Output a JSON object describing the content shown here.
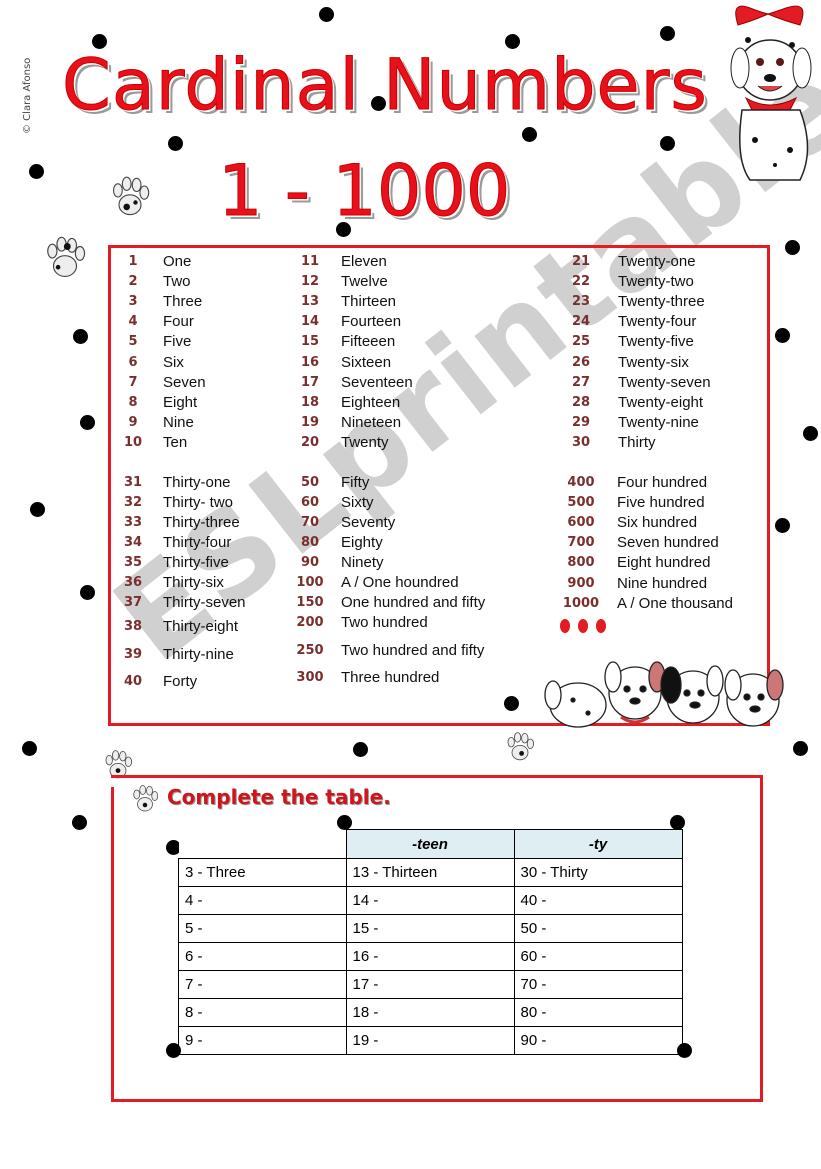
{
  "page": {
    "copyright": "© Clara Afonso",
    "title": "Cardinal Numbers",
    "subtitle": "1 - 1000",
    "watermark": "ESLprintables.com"
  },
  "colors": {
    "title_red": "#e8101a",
    "frame_red": "#e31b23",
    "number_brown": "#7a2e2e",
    "table_header_bg": "#dfeef2"
  },
  "numbers": {
    "col1": [
      {
        "n": "1",
        "w": "One"
      },
      {
        "n": "2",
        "w": "Two"
      },
      {
        "n": "3",
        "w": "Three"
      },
      {
        "n": "4",
        "w": "Four"
      },
      {
        "n": "5",
        "w": "Five"
      },
      {
        "n": "6",
        "w": "Six"
      },
      {
        "n": "7",
        "w": "Seven"
      },
      {
        "n": "8",
        "w": "Eight"
      },
      {
        "n": "9",
        "w": "Nine"
      },
      {
        "n": "10",
        "w": "Ten"
      }
    ],
    "col2": [
      {
        "n": "11",
        "w": "Eleven"
      },
      {
        "n": "12",
        "w": "Twelve"
      },
      {
        "n": "13",
        "w": "Thirteen"
      },
      {
        "n": "14",
        "w": "Fourteen"
      },
      {
        "n": "15",
        "w": "Fifteeen"
      },
      {
        "n": "16",
        "w": "Sixteen"
      },
      {
        "n": "17",
        "w": "Seventeen"
      },
      {
        "n": "18",
        "w": "Eighteen"
      },
      {
        "n": "19",
        "w": "Nineteen"
      },
      {
        "n": "20",
        "w": "Twenty"
      }
    ],
    "col3": [
      {
        "n": "21",
        "w": "Twenty-one"
      },
      {
        "n": "22",
        "w": "Twenty-two"
      },
      {
        "n": "23",
        "w": "Twenty-three"
      },
      {
        "n": "24",
        "w": "Twenty-four"
      },
      {
        "n": "25",
        "w": "Twenty-five"
      },
      {
        "n": "26",
        "w": "Twenty-six"
      },
      {
        "n": "27",
        "w": "Twenty-seven"
      },
      {
        "n": "28",
        "w": "Twenty-eight"
      },
      {
        "n": "29",
        "w": "Twenty-nine"
      },
      {
        "n": "30",
        "w": "Thirty"
      }
    ],
    "col4": [
      {
        "n": "31",
        "w": "Thirty-one"
      },
      {
        "n": "32",
        "w": "Thirty- two"
      },
      {
        "n": "33",
        "w": "Thirty-three"
      },
      {
        "n": "34",
        "w": "Thirty-four"
      },
      {
        "n": "35",
        "w": "Thirty-five"
      },
      {
        "n": "36",
        "w": "Thirty-six"
      },
      {
        "n": "37",
        "w": "Thirty-seven"
      },
      {
        "n": "38",
        "w": "Thirty-eight"
      },
      {
        "n": "39",
        "w": "Thirty-nine"
      },
      {
        "n": "40",
        "w": "Forty"
      }
    ],
    "col5": [
      {
        "n": "50",
        "w": "Fifty"
      },
      {
        "n": "60",
        "w": "Sixty"
      },
      {
        "n": "70",
        "w": "Seventy"
      },
      {
        "n": "80",
        "w": "Eighty"
      },
      {
        "n": "90",
        "w": "Ninety"
      },
      {
        "n": "100",
        "w": "A / One houndred"
      },
      {
        "n": "150",
        "w": "One hundred and fifty"
      },
      {
        "n": "200",
        "w": "Two hundred"
      },
      {
        "n": "250",
        "w": "Two hundred and fifty"
      },
      {
        "n": "300",
        "w": "Three hundred"
      }
    ],
    "col6": [
      {
        "n": "400",
        "w": "Four hundred"
      },
      {
        "n": "500",
        "w": "Five hundred"
      },
      {
        "n": "600",
        "w": "Six hundred"
      },
      {
        "n": "700",
        "w": "Seven hundred"
      },
      {
        "n": "800",
        "w": "Eight hundred"
      },
      {
        "n": "900",
        "w": "Nine hundred"
      },
      {
        "n": "1000",
        "w": "A / One thousand"
      }
    ]
  },
  "exercise": {
    "title": "Complete the table.",
    "headers": [
      "",
      "-teen",
      "-ty"
    ],
    "rows": [
      [
        "3 - Three",
        "13 - Thirteen",
        "30 - Thirty"
      ],
      [
        "4 -",
        "14 -",
        "40 -"
      ],
      [
        "5 -",
        "15 -",
        "50 -"
      ],
      [
        "6 -",
        "16 -",
        "60 -"
      ],
      [
        "7 -",
        "17 -",
        "70 -"
      ],
      [
        "8 -",
        "18 -",
        "80 -"
      ],
      [
        "9 -",
        "19 -",
        "90 -"
      ]
    ]
  }
}
